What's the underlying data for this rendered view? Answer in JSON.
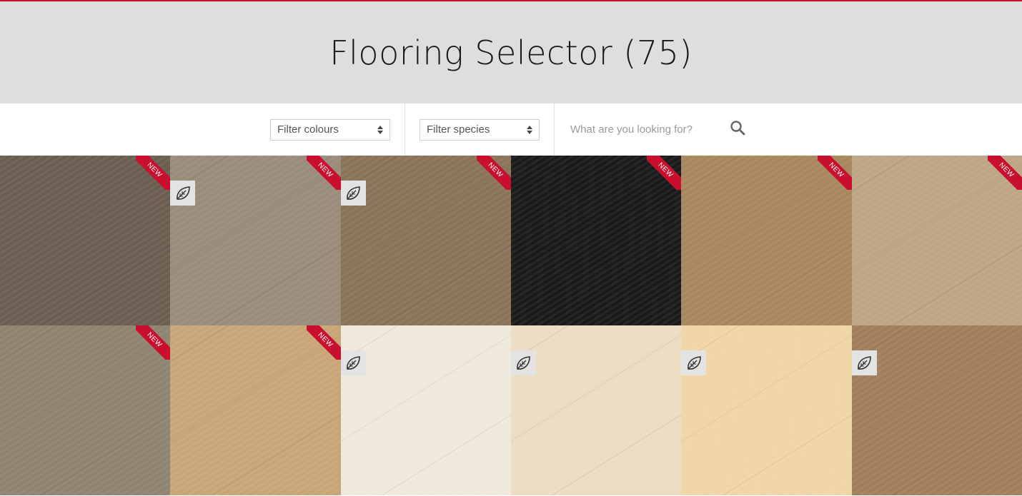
{
  "header": {
    "title": "Flooring Selector (75)"
  },
  "filters": {
    "colours_label": "Filter colours",
    "species_label": "Filter species",
    "search_placeholder": "What are you looking for?"
  },
  "accent_color": "#c8102e",
  "products": [
    {
      "color": "#6b5e51",
      "new": true,
      "eco": false
    },
    {
      "color": "#9a8b7b",
      "new": true,
      "eco": true
    },
    {
      "color": "#8a7359",
      "new": true,
      "eco": true
    },
    {
      "color": "#1b1b1b",
      "new": true,
      "eco": false
    },
    {
      "color": "#a9875e",
      "new": true,
      "eco": false
    },
    {
      "color": "#bda585",
      "new": true,
      "eco": false
    },
    {
      "color": "#8e8470",
      "new": true,
      "eco": false
    },
    {
      "color": "#c8a576",
      "new": true,
      "eco": false
    },
    {
      "color": "#efe8dc",
      "new": false,
      "eco": true
    },
    {
      "color": "#ecdcc2",
      "new": false,
      "eco": true
    },
    {
      "color": "#f0d6a6",
      "new": false,
      "eco": true
    },
    {
      "color": "#a27f5c",
      "new": false,
      "eco": true
    }
  ],
  "badges": {
    "new_label": "NEW",
    "eco_icon": "leaf-icon"
  }
}
